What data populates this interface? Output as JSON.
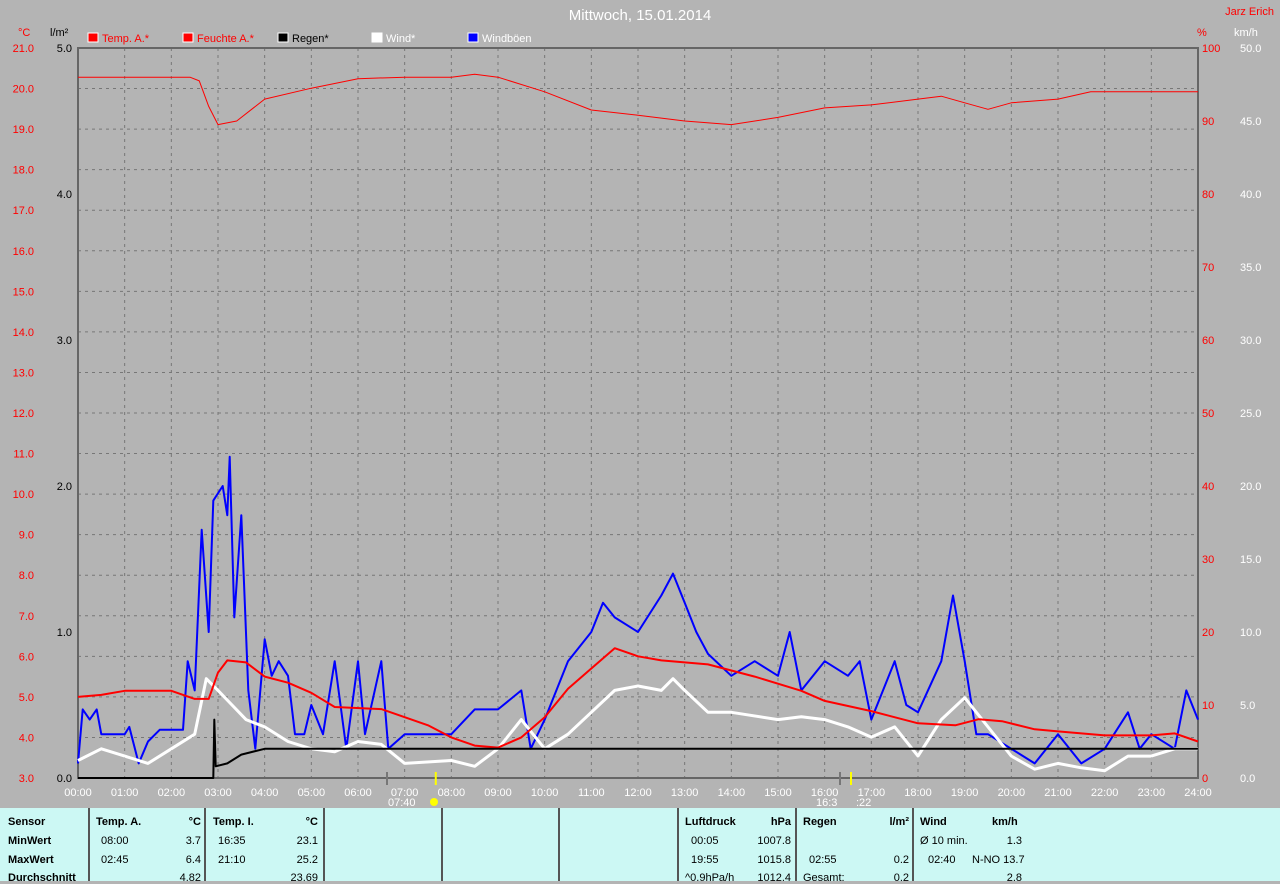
{
  "title": "Mittwoch, 15.01.2014",
  "author": "Jarz Erich",
  "colors": {
    "temp": "#ff0000",
    "humidity": "#ff0000",
    "rain": "#000000",
    "wind": "#ffffff",
    "gust": "#0000ff",
    "grid": "#808080",
    "table_bg": "#ccf8f4"
  },
  "chart_data": {
    "type": "line",
    "title": "Mittwoch, 15.01.2014",
    "legend": [
      "Temp. A.*",
      "Feuchte A.*",
      "Regen*",
      "Wind*",
      "Windböen"
    ],
    "axes": {
      "temp": {
        "unit": "°C",
        "range": [
          3,
          21
        ],
        "ticks": [
          "3.0",
          "4.0",
          "5.0",
          "6.0",
          "7.0",
          "8.0",
          "9.0",
          "10.0",
          "11.0",
          "12.0",
          "13.0",
          "14.0",
          "15.0",
          "16.0",
          "17.0",
          "18.0",
          "19.0",
          "20.0",
          "21.0"
        ]
      },
      "rain": {
        "unit": "l/m²",
        "range": [
          0,
          5
        ],
        "ticks": [
          "0.0",
          "1.0",
          "2.0",
          "3.0",
          "4.0",
          "5.0"
        ]
      },
      "humidity": {
        "unit": "%",
        "range": [
          0,
          100
        ],
        "ticks": [
          "0",
          "10",
          "20",
          "30",
          "40",
          "50",
          "60",
          "70",
          "80",
          "90",
          "100"
        ]
      },
      "wind": {
        "unit": "km/h",
        "range": [
          0,
          50
        ],
        "ticks": [
          "0.0",
          "5.0",
          "10.0",
          "15.0",
          "20.0",
          "25.0",
          "30.0",
          "35.0",
          "40.0",
          "45.0",
          "50.0"
        ]
      },
      "x": {
        "range": [
          0,
          24
        ],
        "ticks": [
          "00:00",
          "01:00",
          "02:00",
          "03:00",
          "04:00",
          "05:00",
          "06:00",
          "07:00",
          "08:00",
          "09:00",
          "10:00",
          "11:00",
          "12:00",
          "13:00",
          "14:00",
          "15:00",
          "16:00",
          "17:00",
          "18:00",
          "19:00",
          "20:00",
          "21:00",
          "22:00",
          "23:00",
          "24:00"
        ]
      }
    },
    "series": [
      {
        "name": "Feuchte A.*",
        "axis": "humidity",
        "points": [
          [
            0,
            96
          ],
          [
            2.4,
            96
          ],
          [
            2.6,
            95.5
          ],
          [
            2.8,
            92
          ],
          [
            3,
            89.5
          ],
          [
            3.4,
            90
          ],
          [
            4,
            93
          ],
          [
            5,
            94.5
          ],
          [
            6,
            95.8
          ],
          [
            7,
            96
          ],
          [
            8,
            96
          ],
          [
            8.5,
            96.4
          ],
          [
            9,
            96
          ],
          [
            10,
            94
          ],
          [
            11,
            91.5
          ],
          [
            12,
            90.8
          ],
          [
            13,
            90
          ],
          [
            14,
            89.5
          ],
          [
            15,
            90.5
          ],
          [
            16,
            91.8
          ],
          [
            17,
            92.2
          ],
          [
            18,
            93
          ],
          [
            18.5,
            93.4
          ],
          [
            19,
            92.5
          ],
          [
            19.5,
            91.6
          ],
          [
            20,
            92.5
          ],
          [
            21,
            93
          ],
          [
            21.7,
            94
          ],
          [
            23,
            94
          ],
          [
            24,
            94
          ]
        ]
      },
      {
        "name": "Temp. A.*",
        "axis": "temp",
        "points": [
          [
            0,
            5
          ],
          [
            0.5,
            5.05
          ],
          [
            1,
            5.15
          ],
          [
            2,
            5.15
          ],
          [
            2.5,
            4.95
          ],
          [
            2.8,
            4.95
          ],
          [
            3,
            5.6
          ],
          [
            3.2,
            5.9
          ],
          [
            3.6,
            5.85
          ],
          [
            4,
            5.5
          ],
          [
            4.5,
            5.35
          ],
          [
            5,
            5.1
          ],
          [
            5.5,
            4.75
          ],
          [
            6.5,
            4.7
          ],
          [
            7,
            4.5
          ],
          [
            7.5,
            4.3
          ],
          [
            8,
            4.0
          ],
          [
            8.5,
            3.8
          ],
          [
            9,
            3.75
          ],
          [
            9.5,
            4.0
          ],
          [
            10,
            4.5
          ],
          [
            10.5,
            5.2
          ],
          [
            11,
            5.7
          ],
          [
            11.5,
            6.2
          ],
          [
            12,
            6.0
          ],
          [
            12.5,
            5.9
          ],
          [
            13.5,
            5.8
          ],
          [
            14.5,
            5.5
          ],
          [
            15.5,
            5.15
          ],
          [
            16,
            4.9
          ],
          [
            17,
            4.65
          ],
          [
            18,
            4.35
          ],
          [
            18.8,
            4.3
          ],
          [
            19.3,
            4.45
          ],
          [
            19.8,
            4.4
          ],
          [
            20.5,
            4.2
          ],
          [
            21,
            4.15
          ],
          [
            22,
            4.05
          ],
          [
            23,
            4.05
          ],
          [
            23.5,
            4.1
          ],
          [
            24,
            3.9
          ]
        ]
      },
      {
        "name": "Regen*",
        "axis": "rain",
        "points": [
          [
            0,
            0
          ],
          [
            2.9,
            0
          ],
          [
            2.92,
            0.4
          ],
          [
            2.95,
            0.08
          ],
          [
            3.2,
            0.1
          ],
          [
            3.5,
            0.16
          ],
          [
            4,
            0.2
          ],
          [
            24,
            0.2
          ]
        ]
      },
      {
        "name": "Wind*",
        "axis": "wind",
        "points": [
          [
            0,
            1.2
          ],
          [
            0.5,
            2
          ],
          [
            1,
            1.5
          ],
          [
            1.5,
            1
          ],
          [
            2,
            2
          ],
          [
            2.5,
            3
          ],
          [
            2.75,
            6.8
          ],
          [
            3,
            6
          ],
          [
            3.3,
            5
          ],
          [
            3.6,
            4
          ],
          [
            4,
            3.5
          ],
          [
            4.5,
            2.5
          ],
          [
            5,
            2
          ],
          [
            5.5,
            1.8
          ],
          [
            6,
            2.5
          ],
          [
            6.5,
            2.3
          ],
          [
            7,
            1
          ],
          [
            8,
            1.2
          ],
          [
            8.5,
            0.8
          ],
          [
            9,
            2
          ],
          [
            9.5,
            4
          ],
          [
            10,
            2
          ],
          [
            10.5,
            3
          ],
          [
            11,
            4.5
          ],
          [
            11.5,
            6
          ],
          [
            12,
            6.3
          ],
          [
            12.5,
            6
          ],
          [
            12.75,
            6.8
          ],
          [
            13,
            6
          ],
          [
            13.5,
            4.5
          ],
          [
            14,
            4.5
          ],
          [
            15,
            4
          ],
          [
            15.5,
            4.2
          ],
          [
            16,
            4
          ],
          [
            16.5,
            3.5
          ],
          [
            17,
            2.8
          ],
          [
            17.5,
            3.5
          ],
          [
            18,
            1.5
          ],
          [
            18.5,
            4
          ],
          [
            19,
            5.5
          ],
          [
            19.5,
            3.5
          ],
          [
            20,
            1.5
          ],
          [
            20.5,
            0.6
          ],
          [
            21,
            1
          ],
          [
            21.5,
            0.7
          ],
          [
            22,
            0.5
          ],
          [
            22.5,
            1.5
          ],
          [
            23,
            1.5
          ],
          [
            23.5,
            2
          ],
          [
            24,
            2
          ]
        ]
      },
      {
        "name": "Windböen",
        "axis": "wind",
        "points": [
          [
            0,
            1
          ],
          [
            0.1,
            4.7
          ],
          [
            0.25,
            4
          ],
          [
            0.4,
            4.7
          ],
          [
            0.5,
            3
          ],
          [
            1,
            3
          ],
          [
            1.1,
            3.5
          ],
          [
            1.3,
            1
          ],
          [
            1.5,
            2.5
          ],
          [
            1.75,
            3.3
          ],
          [
            2.25,
            3.3
          ],
          [
            2.35,
            8
          ],
          [
            2.5,
            6
          ],
          [
            2.65,
            17
          ],
          [
            2.8,
            10
          ],
          [
            2.9,
            19
          ],
          [
            3.1,
            20
          ],
          [
            3.2,
            18
          ],
          [
            3.25,
            22
          ],
          [
            3.35,
            11
          ],
          [
            3.5,
            18
          ],
          [
            3.65,
            6
          ],
          [
            3.8,
            2
          ],
          [
            4,
            9.5
          ],
          [
            4.15,
            7
          ],
          [
            4.3,
            8
          ],
          [
            4.5,
            7
          ],
          [
            4.65,
            3
          ],
          [
            4.85,
            3
          ],
          [
            5,
            5
          ],
          [
            5.25,
            3
          ],
          [
            5.5,
            8
          ],
          [
            5.75,
            2
          ],
          [
            6,
            8
          ],
          [
            6.15,
            3
          ],
          [
            6.5,
            8
          ],
          [
            6.65,
            2
          ],
          [
            7,
            3
          ],
          [
            7.5,
            3
          ],
          [
            8,
            3
          ],
          [
            8.5,
            4.7
          ],
          [
            9,
            4.7
          ],
          [
            9.5,
            6
          ],
          [
            9.7,
            2
          ],
          [
            10,
            4
          ],
          [
            10.5,
            8
          ],
          [
            11,
            10
          ],
          [
            11.25,
            12
          ],
          [
            11.5,
            11
          ],
          [
            12,
            10
          ],
          [
            12.5,
            12.5
          ],
          [
            12.75,
            14
          ],
          [
            13,
            12
          ],
          [
            13.25,
            10
          ],
          [
            13.5,
            8.5
          ],
          [
            14,
            7
          ],
          [
            14.5,
            8
          ],
          [
            15,
            7
          ],
          [
            15.25,
            10
          ],
          [
            15.5,
            6
          ],
          [
            16,
            8
          ],
          [
            16.5,
            7
          ],
          [
            16.75,
            8
          ],
          [
            17,
            4
          ],
          [
            17.5,
            8
          ],
          [
            17.75,
            5
          ],
          [
            18,
            4.5
          ],
          [
            18.5,
            8
          ],
          [
            18.75,
            12.5
          ],
          [
            19,
            8
          ],
          [
            19.25,
            3
          ],
          [
            19.5,
            3
          ],
          [
            20,
            2
          ],
          [
            20.5,
            1
          ],
          [
            21,
            3
          ],
          [
            21.5,
            1
          ],
          [
            22,
            2
          ],
          [
            22.5,
            4.5
          ],
          [
            22.75,
            2
          ],
          [
            23,
            3
          ],
          [
            23.5,
            2
          ],
          [
            23.75,
            6
          ],
          [
            24,
            4
          ]
        ]
      }
    ],
    "markers": {
      "sunrise": "07:40",
      "sunset_label": "16:3",
      "sunset_label2": ":22"
    }
  },
  "table": {
    "sensor": {
      "h": "Sensor",
      "r1": "MinWert",
      "r2": "MaxWert",
      "r3": "Durchschnitt"
    },
    "temp_a": {
      "h": "Temp. A.",
      "u": "°C",
      "t1": "08:00",
      "v1": "3.7",
      "t2": "02:45",
      "v2": "6.4",
      "v3": "4.82"
    },
    "temp_i": {
      "h": "Temp. I.",
      "u": "°C",
      "t1": "16:35",
      "v1": "23.1",
      "t2": "21:10",
      "v2": "25.2",
      "v3": "23.69"
    },
    "pressure": {
      "h": "Luftdruck",
      "u": "hPa",
      "t1": "00:05",
      "v1": "1007.8",
      "t2": "19:55",
      "v2": "1015.8",
      "t3": "^0.9hPa/h",
      "v3": "1012.4"
    },
    "rain": {
      "h": "Regen",
      "u": "l/m²",
      "t2": "02:55",
      "v2": "0.2",
      "t3": "Gesamt:",
      "v3": "0.2"
    },
    "wind": {
      "h": "Wind",
      "u": "km/h",
      "t1": "Ø 10 min.",
      "v1": "1.3",
      "t2": "02:40",
      "v2": "N-NO 13.7",
      "v3": "2.8"
    }
  }
}
